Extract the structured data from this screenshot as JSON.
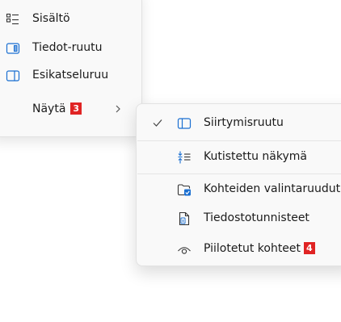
{
  "left_menu": {
    "items": [
      {
        "label": "Sisältö",
        "icon": "content-list-icon"
      },
      {
        "label": "Tiedot-ruutu",
        "icon": "details-pane-icon"
      },
      {
        "label": "Esikatseluruu",
        "icon": "preview-pane-icon"
      },
      {
        "label": "Näytä",
        "badge": "3",
        "icon": "chevron-right-icon"
      }
    ]
  },
  "submenu": {
    "items": [
      {
        "label": "Siirtymisruutu",
        "checked": true,
        "icon": "navigation-pane-icon"
      },
      {
        "label": "Kutistettu näkymä",
        "icon": "compact-view-icon"
      },
      {
        "label": "Kohteiden valintaruudut",
        "icon": "item-checkboxes-icon"
      },
      {
        "label": "Tiedostotunnisteet",
        "icon": "file-extension-icon"
      },
      {
        "label": "Piilotetut kohteet",
        "badge": "4",
        "icon": "hidden-items-eye-icon"
      }
    ]
  },
  "colors": {
    "badge": "#e02424",
    "accent_icon": "#1a6fd1",
    "menu_bg": "#f9f9f9"
  }
}
